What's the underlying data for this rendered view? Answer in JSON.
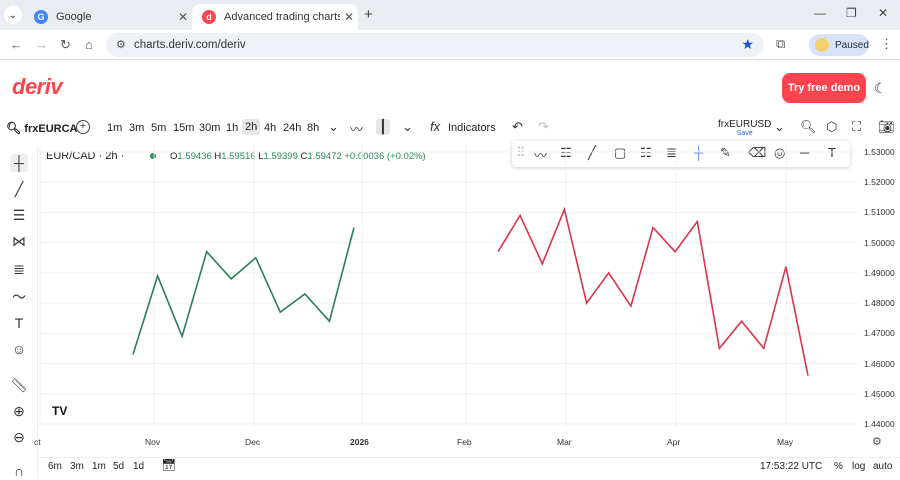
{
  "browser": {
    "tabs": [
      {
        "title": "Google",
        "favicon": "G",
        "color": "#4285f4",
        "active": false
      },
      {
        "title": "Advanced trading charts & tools",
        "favicon": "d",
        "color": "#ff444f",
        "active": true
      }
    ],
    "url": "charts.deriv.com/deriv",
    "profile_status": "Paused"
  },
  "header": {
    "logo": "deriv",
    "demo_button": "Try free demo"
  },
  "toolbar": {
    "symbol": "frxEURCA",
    "timeframes": [
      "1m",
      "3m",
      "5m",
      "15m",
      "30m",
      "1h",
      "2h",
      "4h",
      "24h",
      "8h"
    ],
    "selected_timeframe": "2h",
    "indicators_label": "Indicators",
    "compare_pair": "frxEURUSD",
    "save_label": "Save"
  },
  "chart": {
    "title": "EUR/CAD · 2h ·",
    "ohlc": {
      "o_label": "O",
      "o": "1.59436",
      "h_label": "H",
      "h": "1.59516",
      "l_label": "L",
      "l": "1.59399",
      "c_label": "C",
      "c": "1.59472",
      "change": "+0.00036 (+0.02%)"
    },
    "watermark": "TV"
  },
  "bottom": {
    "ranges": [
      "6m",
      "3m",
      "1m",
      "5d",
      "1d"
    ],
    "clock": "17:53:22 UTC",
    "percent": "%",
    "log": "log",
    "auto": "auto"
  },
  "colors": {
    "accent": "#ff444f",
    "green_line": "#2e7d5b",
    "red_line": "#d9364e"
  },
  "chart_data": {
    "type": "line",
    "x_ticks": [
      "ct",
      "Nov",
      "Dec",
      "2026",
      "Feb",
      "Mar",
      "Apr",
      "May"
    ],
    "y_ticks": [
      "1.53000",
      "1.52000",
      "1.51000",
      "1.50000",
      "1.49000",
      "1.48000",
      "1.47000",
      "1.46000",
      "1.45000",
      "1.44000"
    ],
    "ylim": [
      1.44,
      1.53
    ],
    "series": [
      {
        "color": "#2e7d5b",
        "values": [
          1.463,
          1.489,
          1.469,
          1.497,
          1.488,
          1.495,
          1.477,
          1.483,
          1.474,
          1.505
        ]
      },
      {
        "color": "#d9364e",
        "values": [
          1.497,
          1.509,
          1.493,
          1.511,
          1.48,
          1.49,
          1.479,
          1.505,
          1.497,
          1.507,
          1.465,
          1.474,
          1.465,
          1.492,
          1.456
        ]
      }
    ]
  }
}
